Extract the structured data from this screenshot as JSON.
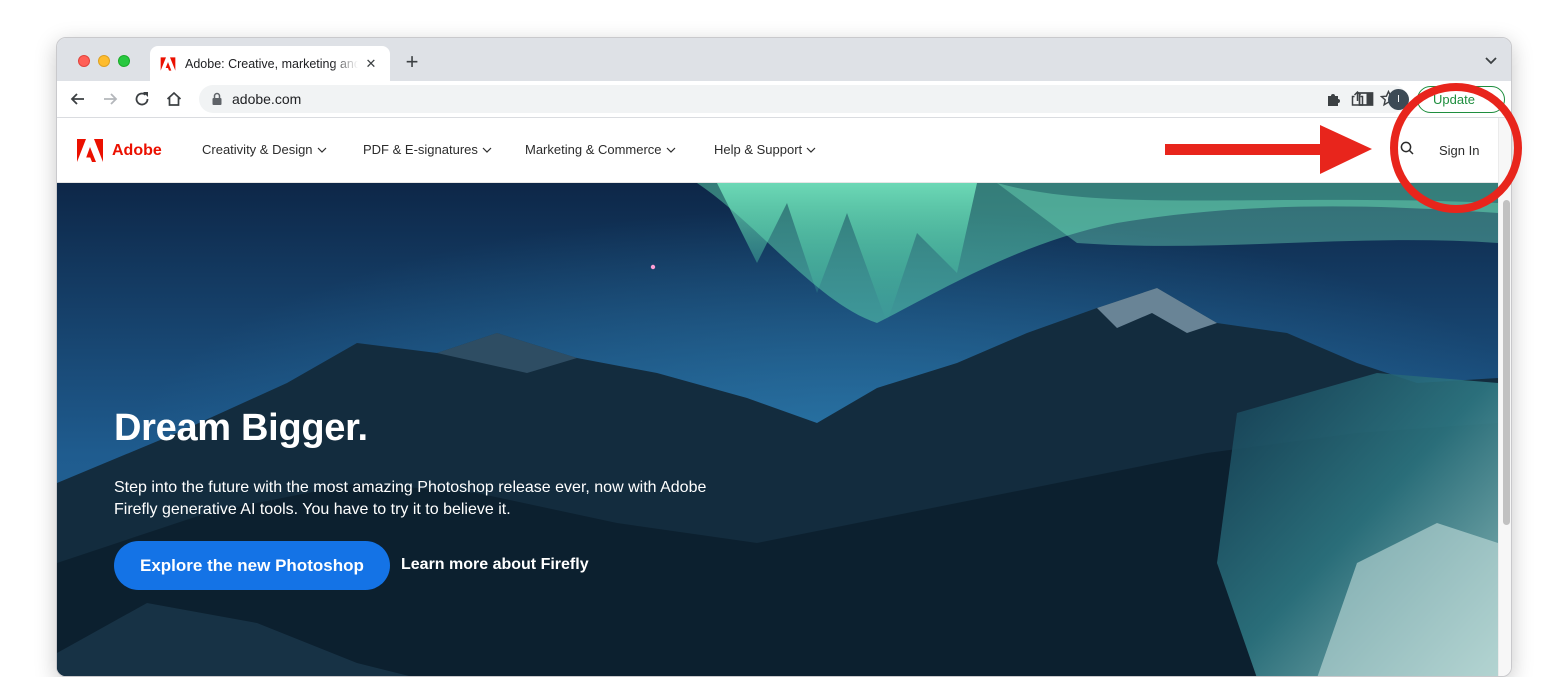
{
  "browser": {
    "tab": {
      "title": "Adobe: Creative, marketing and document management solutions",
      "close_glyph": "✕"
    },
    "new_tab_glyph": "+",
    "address": {
      "url": "adobe.com"
    },
    "profile_initial": "I",
    "update_label": "Update"
  },
  "site": {
    "brand": "Adobe",
    "brand_color": "#eb1000",
    "nav": [
      {
        "label": "Creativity & Design"
      },
      {
        "label": "PDF & E-signatures"
      },
      {
        "label": "Marketing & Commerce"
      },
      {
        "label": "Help & Support"
      }
    ],
    "sign_in": "Sign In"
  },
  "hero": {
    "title": "Dream Bigger.",
    "description": "Step into the future with the most amazing Photoshop release ever, now with Adobe Firefly generative AI tools. You have to try it to believe it.",
    "primary_cta": "Explore the new Photoshop",
    "secondary_cta": "Learn more about Firefly",
    "cta_color": "#1473e6"
  },
  "annotation": {
    "arrow_color": "#e8251c",
    "circle_color": "#e8251c"
  },
  "icons": [
    "back-icon",
    "forward-icon",
    "reload-icon",
    "home-icon",
    "lock-icon",
    "share-icon",
    "bookmark-star-icon",
    "extensions-icon",
    "side-panel-icon",
    "tab-search-icon",
    "search-icon",
    "chevron-down-icon"
  ]
}
